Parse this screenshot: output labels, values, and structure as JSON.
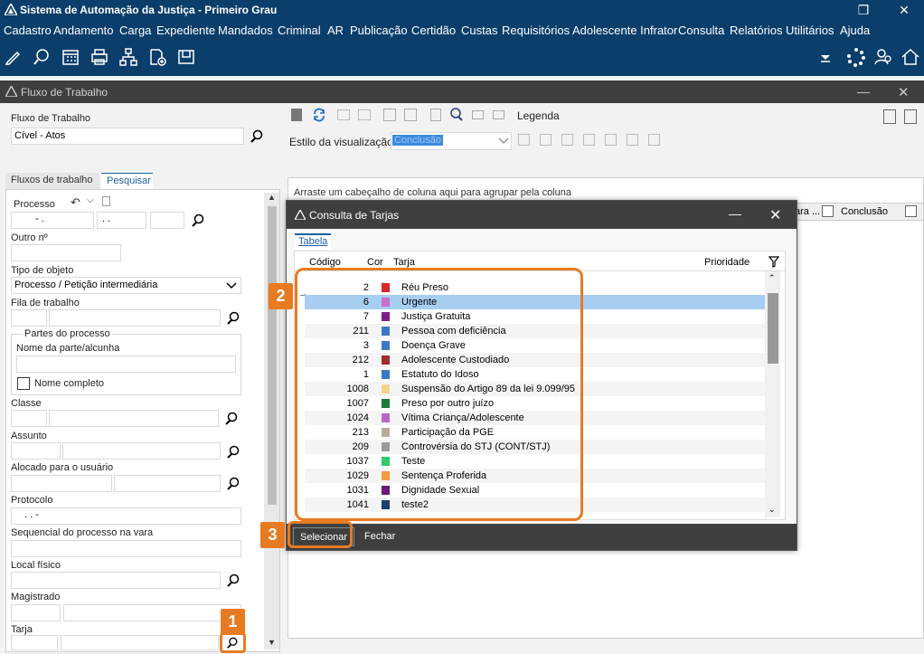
{
  "window": {
    "title": "Sistema de Automação da Justiça - Primeiro Grau",
    "restore": "❐",
    "close": "✕"
  },
  "menu": [
    "Cadastro",
    "Andamento",
    "Carga",
    "Expediente",
    "Mandados",
    "Criminal",
    "AR",
    "Publicação",
    "Certidão",
    "Custas",
    "Requisitórios",
    "Adolescente Infrator",
    "Consulta",
    "Relatórios",
    "Utilitários",
    "Ajuda"
  ],
  "fluxo_window": {
    "title": "Fluxo de Trabalho",
    "minimize": "—",
    "close": "✕"
  },
  "form": {
    "fluxo_label": "Fluxo de Trabalho",
    "fluxo_value": "Cível - Atos",
    "estilo_label": "Estilo da visualização",
    "estilo_value": "Conclusão",
    "legenda": "Legenda",
    "tab_fluxos": "Fluxos de trabalho",
    "tab_pesquisar": "Pesquisar",
    "processo_label": "Processo",
    "processo_p1": "- .",
    "processo_p2": ". .",
    "outro_label": "Outro nº",
    "tipo_label": "Tipo de objeto",
    "tipo_value": "Processo / Petição intermediária",
    "fila_label": "Fila de trabalho",
    "partes_label": "Partes do processo",
    "nome_parte_label": "Nome da parte/alcunha",
    "nome_completo": "Nome completo",
    "classe_label": "Classe",
    "assunto_label": "Assunto",
    "alocado_label": "Alocado para o usuário",
    "protocolo_label": "Protocolo",
    "protocolo_value": ". . -",
    "sequencial_label": "Sequencial do processo na vara",
    "local_label": "Local físico",
    "magistrado_label": "Magistrado",
    "tarja_label": "Tarja"
  },
  "grid": {
    "group_hint": "Arraste um cabeçalho de coluna aqui para agrupar pela coluna",
    "col_para": "ara ...",
    "col_conclusao": "Conclusão"
  },
  "dialog": {
    "title": "Consulta de Tarjas",
    "tab": "Tabela",
    "headers": {
      "codigo": "Código",
      "cor": "Cor",
      "tarja": "Tarja",
      "prioridade": "Prioridade"
    },
    "rows": [
      {
        "codigo": "2",
        "tarja": "Réu Preso",
        "color": "#d9262b"
      },
      {
        "codigo": "6",
        "tarja": "Urgente",
        "color": "#c86fc8"
      },
      {
        "codigo": "7",
        "tarja": "Justiça Gratuita",
        "color": "#7b1f8a"
      },
      {
        "codigo": "211",
        "tarja": "Pessoa com deficiência",
        "color": "#3c78c3"
      },
      {
        "codigo": "3",
        "tarja": "Doença Grave",
        "color": "#3c78c3"
      },
      {
        "codigo": "212",
        "tarja": "Adolescente Custodiado",
        "color": "#a02c2c"
      },
      {
        "codigo": "1",
        "tarja": "Estatuto do Idoso",
        "color": "#3c78c3"
      },
      {
        "codigo": "1008",
        "tarja": "Suspensão do Artigo 89 da lei 9.099/95",
        "color": "#f5d58b"
      },
      {
        "codigo": "1007",
        "tarja": "Preso por outro juízo",
        "color": "#1e7a3a"
      },
      {
        "codigo": "1024",
        "tarja": "Vítima Criança/Adolescente",
        "color": "#b767c8"
      },
      {
        "codigo": "213",
        "tarja": "Participação da PGE",
        "color": "#b8ad9c"
      },
      {
        "codigo": "209",
        "tarja": "Controvérsia do STJ (CONT/STJ)",
        "color": "#9a9a9a"
      },
      {
        "codigo": "1037",
        "tarja": "Teste",
        "color": "#2ecc71"
      },
      {
        "codigo": "1029",
        "tarja": "Sentença Proferida",
        "color": "#f39c3c"
      },
      {
        "codigo": "1031",
        "tarja": "Dignidade Sexual",
        "color": "#6a1b7a"
      },
      {
        "codigo": "1041",
        "tarja": "teste2",
        "color": "#1b3f6e"
      }
    ],
    "selecionar": "Selecionar",
    "fechar": "Fechar"
  },
  "badges": {
    "b1": "1",
    "b2": "2",
    "b3": "3"
  },
  "colors": {
    "dark": "#0b3e6a",
    "panel": "#3f3f3f",
    "accent": "#e87b22",
    "selection": "#a7cdf0"
  }
}
